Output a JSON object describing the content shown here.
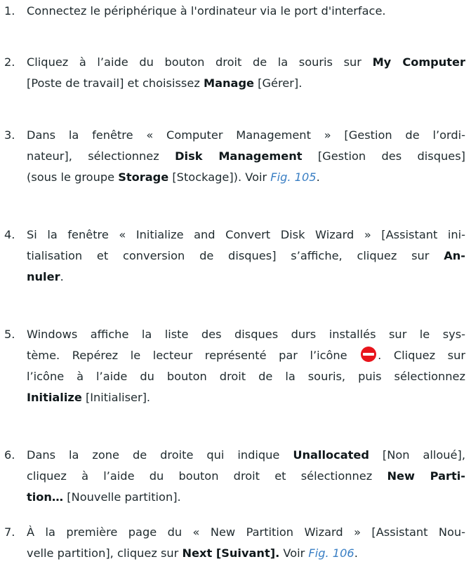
{
  "steps": [
    {
      "num": "1.",
      "lines": [
        [
          "Connectez le périphérique à l'ordinateur via le port d'interface."
        ]
      ]
    },
    {
      "num": "2.",
      "lines": [
        [
          "Cliquez à l’aide du bouton droit de la souris sur ",
          {
            "b": "My Computer"
          }
        ],
        [
          "[Poste de travail] et choisissez ",
          {
            "b": "Manage"
          },
          " [Gérer]."
        ]
      ]
    },
    {
      "num": "3.",
      "lines": [
        [
          "Dans la fenêtre « Computer Management » [Gestion de l’ordi-"
        ],
        [
          "nateur], sélectionnez ",
          {
            "b": "Disk Management"
          },
          " [Gestion des disques]"
        ],
        [
          "(sous le groupe ",
          {
            "b": "Storage"
          },
          " [Stockage]). Voir ",
          {
            "fig": "Fig. 105"
          },
          "."
        ]
      ]
    },
    {
      "num": "4.",
      "lines": [
        [
          "Si la fenêtre « Initialize and Convert Disk Wizard » [Assistant ini-"
        ],
        [
          "tialisation et conversion de disques] s’affiche, cliquez sur ",
          {
            "b": "An-"
          }
        ],
        [
          {
            "b": "nuler"
          },
          "."
        ]
      ]
    },
    {
      "num": "5.",
      "lines": [
        [
          "Windows affiche la liste des disques durs installés sur le sys-"
        ],
        [
          "tème. Repérez le lecteur représenté par l’icône ",
          {
            "icon": "drive-icon"
          },
          ".  Cliquez sur"
        ],
        [
          "l’icône à l’aide du bouton droit de la souris, puis sélectionnez"
        ],
        [
          {
            "b": "Initialize"
          },
          " [Initialiser]."
        ]
      ]
    },
    {
      "num": "6.",
      "lines": [
        [
          "Dans la zone de droite qui indique ",
          {
            "b": "Unallocated"
          },
          " [Non alloué],"
        ],
        [
          "cliquez à l’aide du bouton droit et sélectionnez ",
          {
            "b": "New Parti-"
          }
        ],
        [
          {
            "b": "tion…"
          },
          " [Nouvelle partition]."
        ]
      ]
    },
    {
      "num": "7.",
      "lines": [
        [
          "À la première page du « New Partition Wizard » [Assistant Nou-"
        ],
        [
          "velle partition], cliquez sur ",
          {
            "b": "Next [Suivant]."
          },
          " Voir ",
          {
            "fig": "Fig. 106"
          },
          "."
        ]
      ]
    }
  ]
}
